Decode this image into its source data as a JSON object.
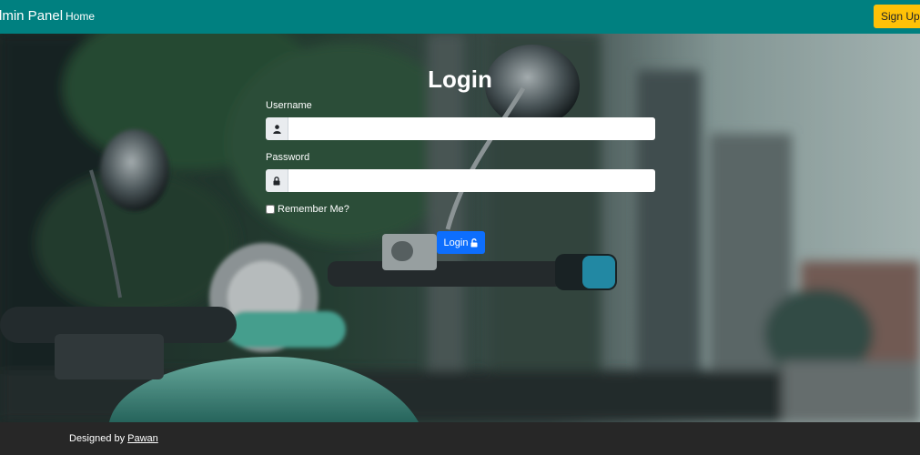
{
  "navbar": {
    "brand": "Admin Panel",
    "home_link": "Home",
    "signup_label": "Sign Up",
    "signup_icon": "unlock-icon",
    "bg_color": "#008080",
    "signup_color": "#ffc107"
  },
  "login": {
    "title": "Login",
    "username_label": "Username",
    "username_icon": "user-icon",
    "username_value": "",
    "password_label": "Password",
    "password_icon": "lock-icon",
    "password_value": "",
    "remember_label": "Remember Me?",
    "remember_checked": false,
    "submit_label": "Login",
    "submit_icon": "unlock-icon",
    "submit_color": "#0d6efd"
  },
  "footer": {
    "text": "Designed by",
    "author": "Pawan",
    "bg_color": "#272727"
  }
}
